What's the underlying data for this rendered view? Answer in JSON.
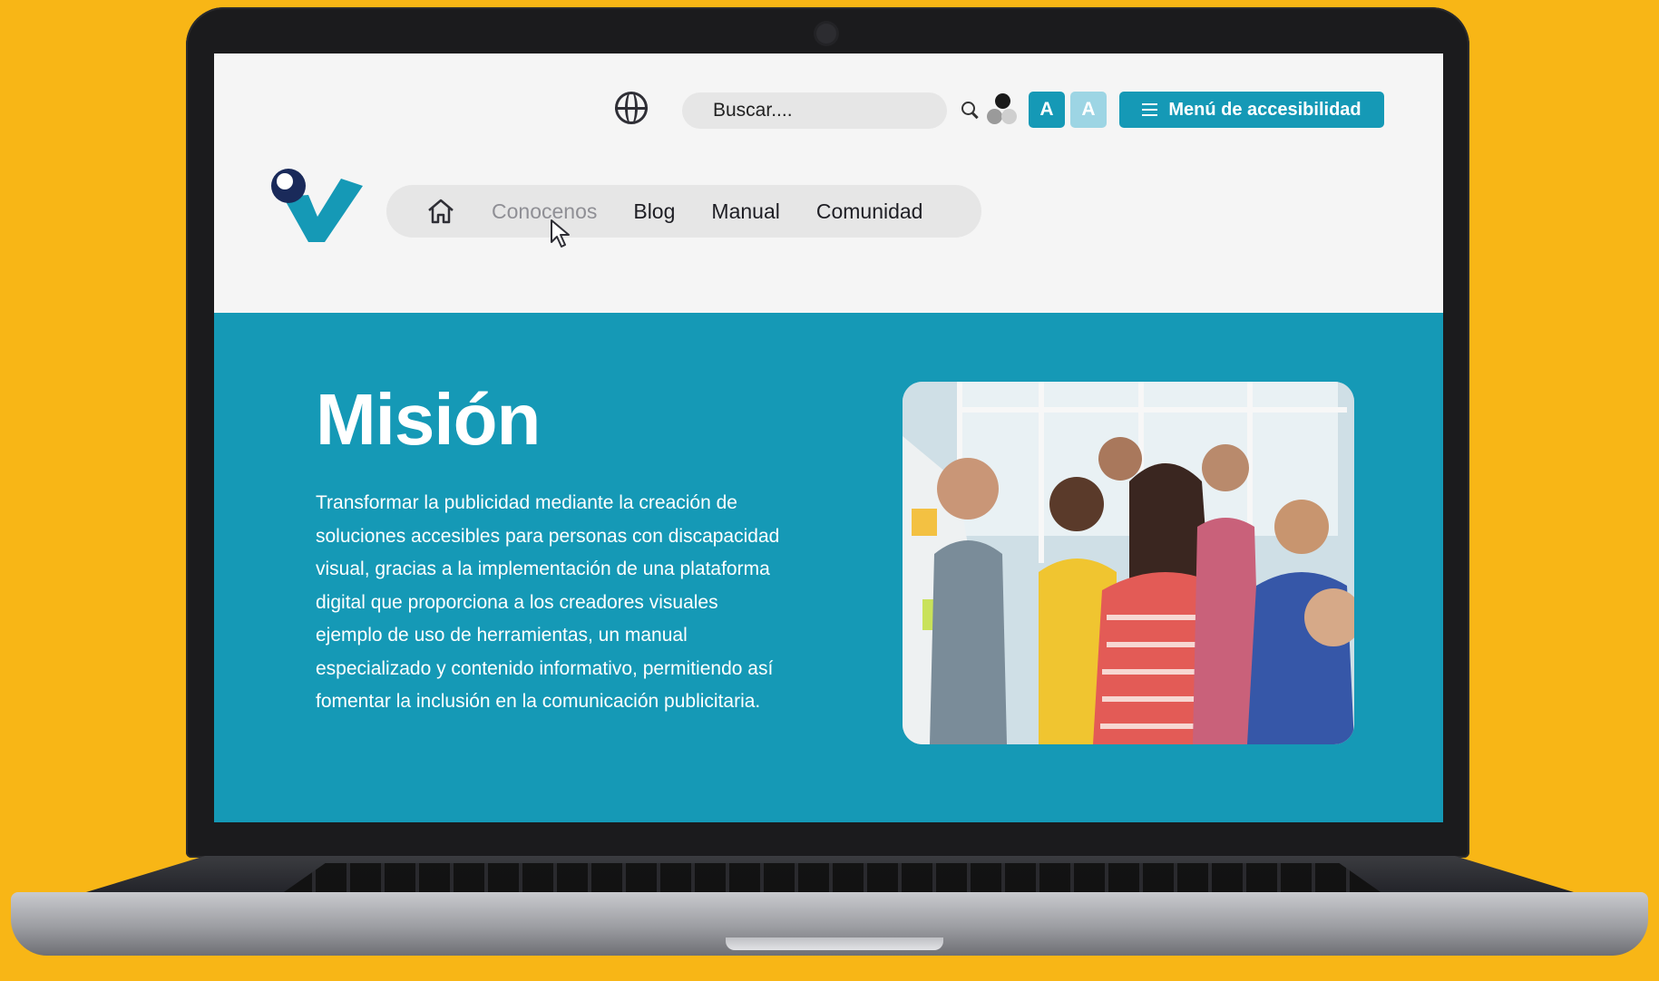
{
  "header": {
    "search": {
      "placeholder": "Buscar...."
    },
    "font_increase_label": "A",
    "font_decrease_label": "A",
    "accessibility_menu_label": "Menú de accesibilidad"
  },
  "nav": {
    "items": [
      {
        "label": "Conocenos"
      },
      {
        "label": "Blog"
      },
      {
        "label": "Manual"
      },
      {
        "label": "Comunidad"
      }
    ]
  },
  "hero": {
    "title": "Misión",
    "text": "Transformar la publicidad mediante la creación de soluciones accesibles para personas con discapacidad visual, gracias a la implementación de una plataforma digital que proporciona a los creadores visuales ejemplo de uso de herramientas, un manual especializado y contenido informativo, permitiendo así fomentar la inclusión en la comunicación publicitaria."
  },
  "colors": {
    "background": "#f8b616",
    "brand": "#1599b6",
    "brand_light": "#9dd5e4",
    "text_dark": "#1e1e24"
  },
  "icons": [
    "globe-icon",
    "search-icon",
    "contrast-icon",
    "hamburger-icon",
    "home-icon",
    "logo-icon",
    "cursor-icon"
  ]
}
